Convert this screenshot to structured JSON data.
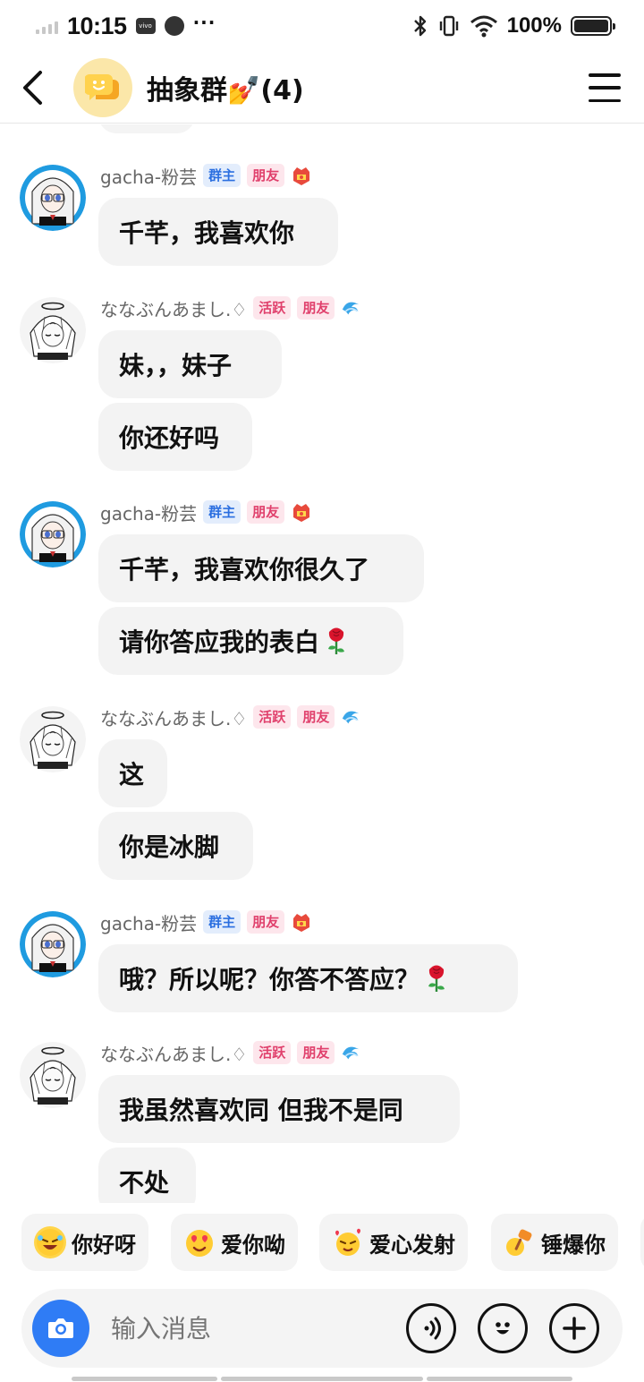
{
  "status_bar": {
    "time": "10:15",
    "battery": "100%",
    "carrier_icon_text": "vivo"
  },
  "header": {
    "title": "抽象群💅(4)",
    "back_icon": "chevron-left-icon",
    "menu_icon": "hamburger-menu-icon"
  },
  "chat": {
    "messages": [
      {
        "sender": "gacha-粉芸",
        "badges": [
          "群主",
          "朋友"
        ],
        "bubbles": [
          "千芊，我喜欢你"
        ]
      },
      {
        "sender": "ななぶんあまし.♢",
        "badges": [
          "活跃",
          "朋友"
        ],
        "bubbles": [
          "妹，，妹子",
          "你还好吗"
        ]
      },
      {
        "sender": "gacha-粉芸",
        "badges": [
          "群主",
          "朋友"
        ],
        "bubbles": [
          "千芊，我喜欢你很久了",
          "请你答应我的表白"
        ]
      },
      {
        "sender": "ななぶんあまし.♢",
        "badges": [
          "活跃",
          "朋友"
        ],
        "bubbles": [
          "这",
          "你是冰脚"
        ]
      },
      {
        "sender": "gacha-粉芸",
        "badges": [
          "群主",
          "朋友"
        ],
        "bubbles": [
          "哦？所以呢？你答不答应？"
        ]
      },
      {
        "sender": "ななぶんあまし.♢",
        "badges": [
          "活跃",
          "朋友"
        ],
        "bubbles": [
          "我虽然喜欢同 但我不是同",
          "不处"
        ]
      }
    ]
  },
  "quick_replies": [
    "你好呀",
    "爱你呦",
    "爱心发射",
    "锤爆你"
  ],
  "input": {
    "placeholder": "输入消息"
  },
  "colors": {
    "accent_blue": "#2f7cf5",
    "owner_badge": "#2b6fe0",
    "friend_badge": "#e0406c",
    "bubble_bg": "#f3f3f3"
  }
}
